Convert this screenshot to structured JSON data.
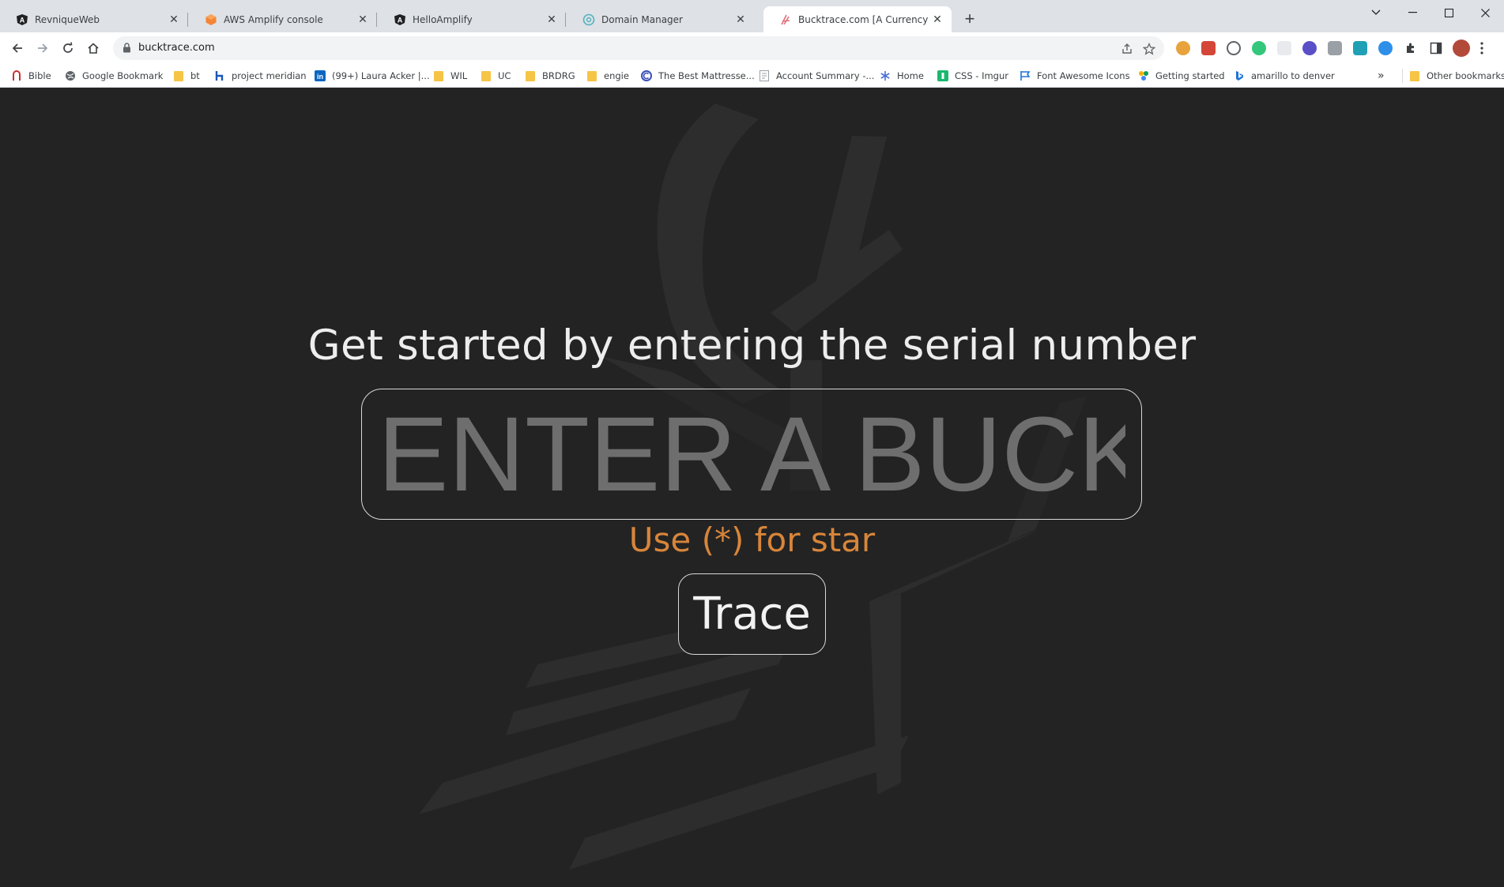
{
  "browser": {
    "tabs": [
      {
        "title": "RevniqueWeb",
        "icon": "angular-icon"
      },
      {
        "title": "AWS Amplify console",
        "icon": "aws-amplify-icon"
      },
      {
        "title": "HelloAmplify",
        "icon": "angular-icon"
      },
      {
        "title": "Domain Manager",
        "icon": "domain-manager-icon"
      },
      {
        "title": "Bucktrace.com [A Currency Track",
        "icon": "bucktrace-icon",
        "active": true
      }
    ],
    "address": {
      "url": "bucktrace.com"
    },
    "bookmarks": [
      {
        "label": "Bible",
        "icon": "bible-icon"
      },
      {
        "label": "Google Bookmark",
        "icon": "globe-icon"
      },
      {
        "label": "bt",
        "icon": "folder-icon"
      },
      {
        "label": "project meridian",
        "icon": "h-icon"
      },
      {
        "label": "(99+) Laura Acker |...",
        "icon": "linkedin-icon"
      },
      {
        "label": "WIL",
        "icon": "folder-icon"
      },
      {
        "label": "UC",
        "icon": "folder-icon"
      },
      {
        "label": "BRDRG",
        "icon": "folder-icon"
      },
      {
        "label": "engie",
        "icon": "folder-icon"
      },
      {
        "label": "The Best Mattresse...",
        "icon": "mattress-icon"
      },
      {
        "label": "Account Summary -...",
        "icon": "document-icon"
      },
      {
        "label": "Home",
        "icon": "snowflake-icon"
      },
      {
        "label": "CSS - Imgur",
        "icon": "imgur-icon"
      },
      {
        "label": "Font Awesome Icons",
        "icon": "flag-icon"
      },
      {
        "label": "Getting started",
        "icon": "getting-started-icon"
      },
      {
        "label": "amarillo to denver",
        "icon": "bing-icon"
      }
    ],
    "overflow_label": "»",
    "other_bookmarks": "Other bookmarks"
  },
  "page": {
    "headline": "Get started by entering the serial number",
    "serial_placeholder": "ENTER A BUCK",
    "hint": "Use (*) for star",
    "trace_label": "Trace"
  },
  "colors": {
    "background": "#232323",
    "hint": "#d8853a",
    "text": "#ededed"
  }
}
